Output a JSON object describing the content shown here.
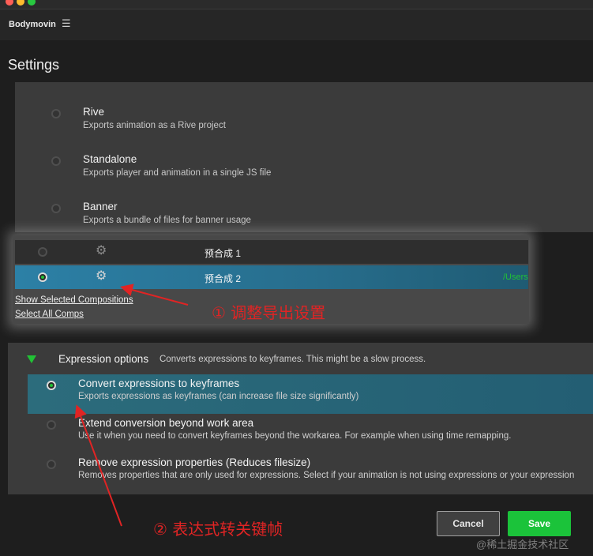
{
  "app": {
    "title": "Bodymovin"
  },
  "page": {
    "title": "Settings"
  },
  "export_modes": [
    {
      "name": "Rive",
      "description": "Exports animation as a Rive project",
      "selected": false
    },
    {
      "name": "Standalone",
      "description": "Exports player and animation in a single JS file",
      "selected": false
    },
    {
      "name": "Banner",
      "description": "Exports a bundle of files for banner usage",
      "selected": false
    }
  ],
  "compositions": {
    "rows": [
      {
        "name": "预合成 1",
        "path": "",
        "selected": false
      },
      {
        "name": "预合成 2",
        "path": "/Users",
        "selected": true
      }
    ],
    "show_selected_label": "Show Selected Compositions",
    "select_all_label": "Select All Comps"
  },
  "expression_options": {
    "title": "Expression options",
    "subtitle": "Converts expressions to keyframes. This might be a slow process.",
    "options": [
      {
        "name": "Convert expressions to keyframes",
        "description": "Exports expressions as keyframes (can increase file size significantly)",
        "selected": true
      },
      {
        "name": "Extend conversion beyond work area",
        "description": "Use it when you need to convert keyframes beyond the workarea. For example when using time remapping.",
        "selected": false
      },
      {
        "name": "Remove expression properties (Reduces filesize)",
        "description": "Removes properties that are only used for expressions. Select if your animation is not using expressions or your expression",
        "selected": false
      }
    ]
  },
  "buttons": {
    "cancel": "Cancel",
    "save": "Save"
  },
  "annotations": {
    "step1": "① 调整导出设置",
    "step2": "② 表达式转关键帧"
  },
  "watermark": "@稀土掘金技术社区",
  "icons": {
    "menu": "hamburger-icon",
    "comp_settings": "gear-icon",
    "expand": "triangle-down-icon"
  },
  "colors": {
    "accent_green": "#21c135",
    "selected_row": "#2c80a6",
    "annotation_red": "#e02424",
    "save_button": "#1bc33a"
  }
}
